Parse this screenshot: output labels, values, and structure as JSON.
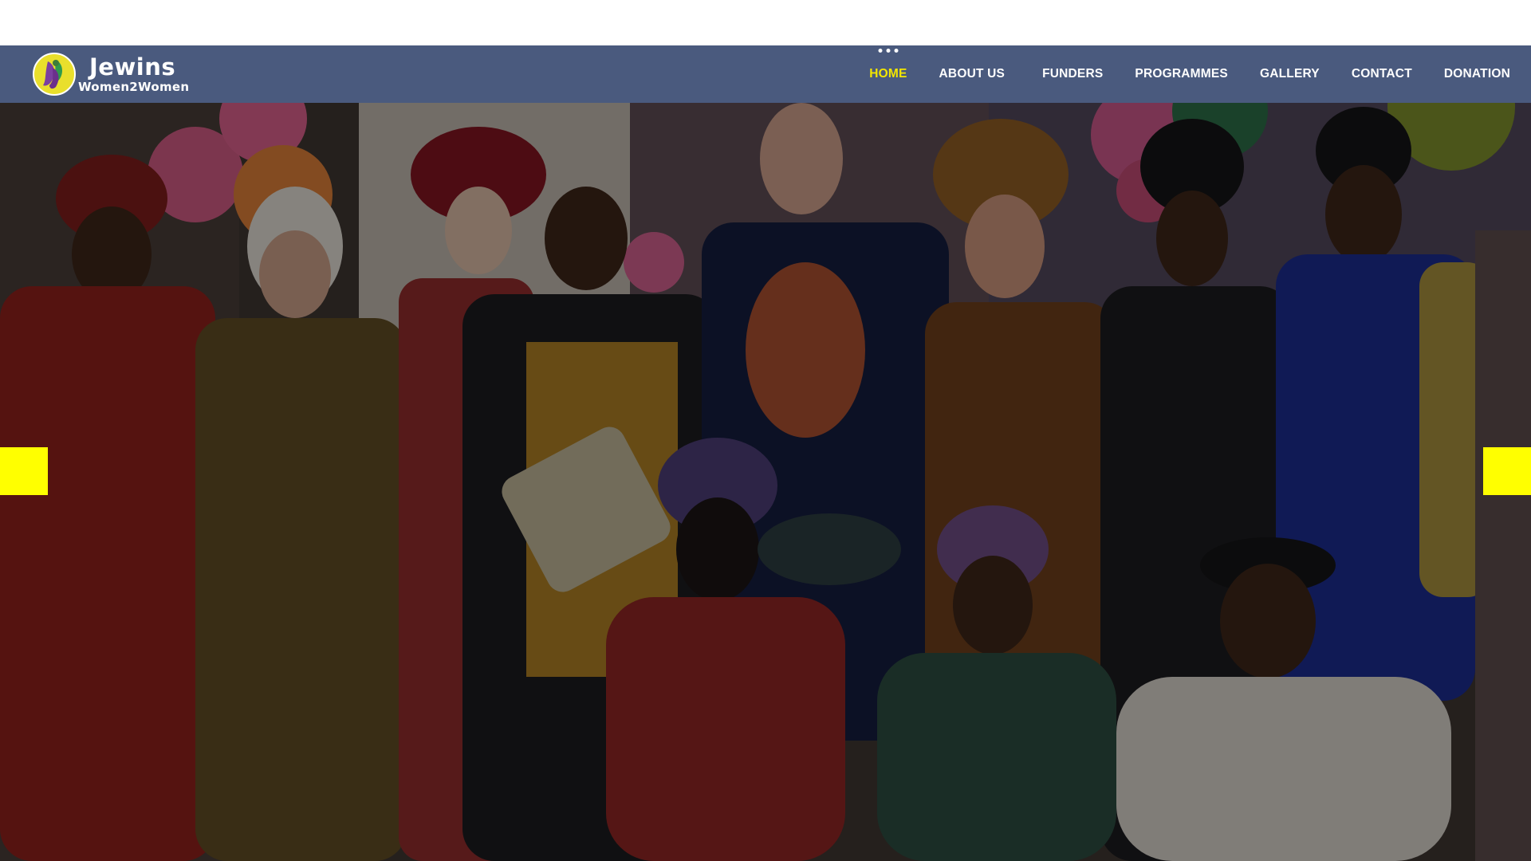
{
  "brand": {
    "name": "Jewins",
    "tagline": "Women2Women",
    "colors": {
      "navbar": "#4a5a7e",
      "accent": "#f3e600",
      "arrow": "#ffff00",
      "text": "#ffffff"
    },
    "logo_icon": "woman-silhouette-circle-logo"
  },
  "nav": {
    "items": [
      {
        "label": "HOME",
        "active": true
      },
      {
        "label": "ABOUT US",
        "active": false
      },
      {
        "label": "FUNDERS",
        "active": false
      },
      {
        "label": "PROGRAMMES",
        "active": false
      },
      {
        "label": "GALLERY",
        "active": false
      },
      {
        "label": "CONTACT",
        "active": false
      },
      {
        "label": "DONATION",
        "active": false
      }
    ]
  },
  "hero": {
    "image_subject": "group photo of community members in colourful African attire",
    "prev_icon": "slider-prev-arrow-icon",
    "next_icon": "slider-next-arrow-icon"
  }
}
